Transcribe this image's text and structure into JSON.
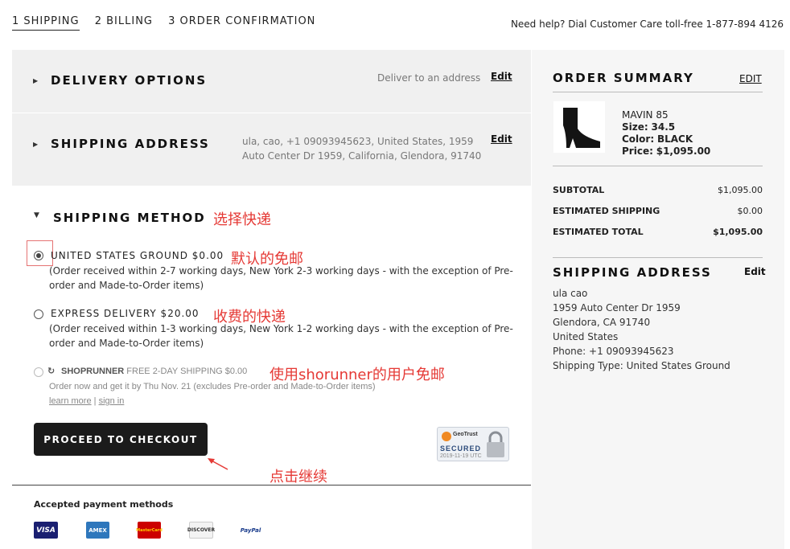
{
  "steps": [
    {
      "label": "1 SHIPPING"
    },
    {
      "label": "2 BILLING"
    },
    {
      "label": "3 ORDER CONFIRMATION"
    }
  ],
  "help": "Need help? Dial Customer Care toll-free 1-877-894 4126",
  "delivery": {
    "title": "DELIVERY OPTIONS",
    "value": "Deliver to an address",
    "edit": "Edit"
  },
  "shipping_address_panel": {
    "title": "SHIPPING ADDRESS",
    "line1": "ula, cao, +1 09093945623, United States, 1959",
    "line2": "Auto Center Dr 1959, California, Glendora, 91740",
    "edit": "Edit"
  },
  "shipping_method": {
    "title": "SHIPPING METHOD",
    "options": [
      {
        "label": "UNITED STATES GROUND $0.00",
        "desc": "(Order received within 2-7 working days, New York 2-3 working days - with the exception of Pre-order and Made-to-Order items)",
        "selected": true
      },
      {
        "label": "EXPRESS DELIVERY $20.00",
        "desc": "(Order received within 1-3 working days, New York 1-2 working days - with the exception of Pre-order and Made-to-Order items)",
        "selected": false
      }
    ],
    "shoprunner": {
      "brand": "SHOPRUNNER",
      "label": "FREE 2-DAY SHIPPING $0.00",
      "desc": "Order now and get it by Thu Nov. 21 (excludes Pre-order and Made-to-Order items)",
      "learn_more": "learn more",
      "sep": "|",
      "sign_in": "sign in"
    }
  },
  "annotations": {
    "select_express": "选择快递",
    "default_free": "默认的免邮",
    "paid_express": "收费的快递",
    "shorunner_free": "使用shorunner的用户免邮",
    "click_continue": "点击继续"
  },
  "checkout_button": "PROCEED TO CHECKOUT",
  "geotrust": {
    "brand": "GeoTrust",
    "secured": "SECURED",
    "date": "2019-11-19 UTC"
  },
  "payment": {
    "title": "Accepted payment methods",
    "cards": [
      "VISA",
      "AMEX",
      "MasterCard",
      "DISCOVER",
      "PayPal"
    ]
  },
  "summary": {
    "title": "ORDER SUMMARY",
    "edit": "EDIT",
    "product": {
      "name": "MAVIN 85",
      "size_label": "Size:",
      "size": "34.5",
      "color_label": "Color:",
      "color": "BLACK",
      "price_label": "Price:",
      "price": "$1,095.00"
    },
    "rows": [
      {
        "label": "SUBTOTAL",
        "value": "$1,095.00"
      },
      {
        "label": "ESTIMATED SHIPPING",
        "value": "$0.00"
      },
      {
        "label": "ESTIMATED TOTAL",
        "value": "$1,095.00"
      }
    ],
    "ship_title": "SHIPPING ADDRESS",
    "ship_edit": "Edit",
    "ship_lines": [
      "ula cao",
      "1959 Auto Center Dr 1959",
      "Glendora, CA 91740",
      "United States",
      "Phone: +1 09093945623",
      "Shipping Type: United States Ground"
    ]
  },
  "colors": {
    "annotation": "#e53935",
    "button": "#1b1b1b",
    "panel": "#f0f0f0",
    "sidebar": "#f6f6f6"
  }
}
